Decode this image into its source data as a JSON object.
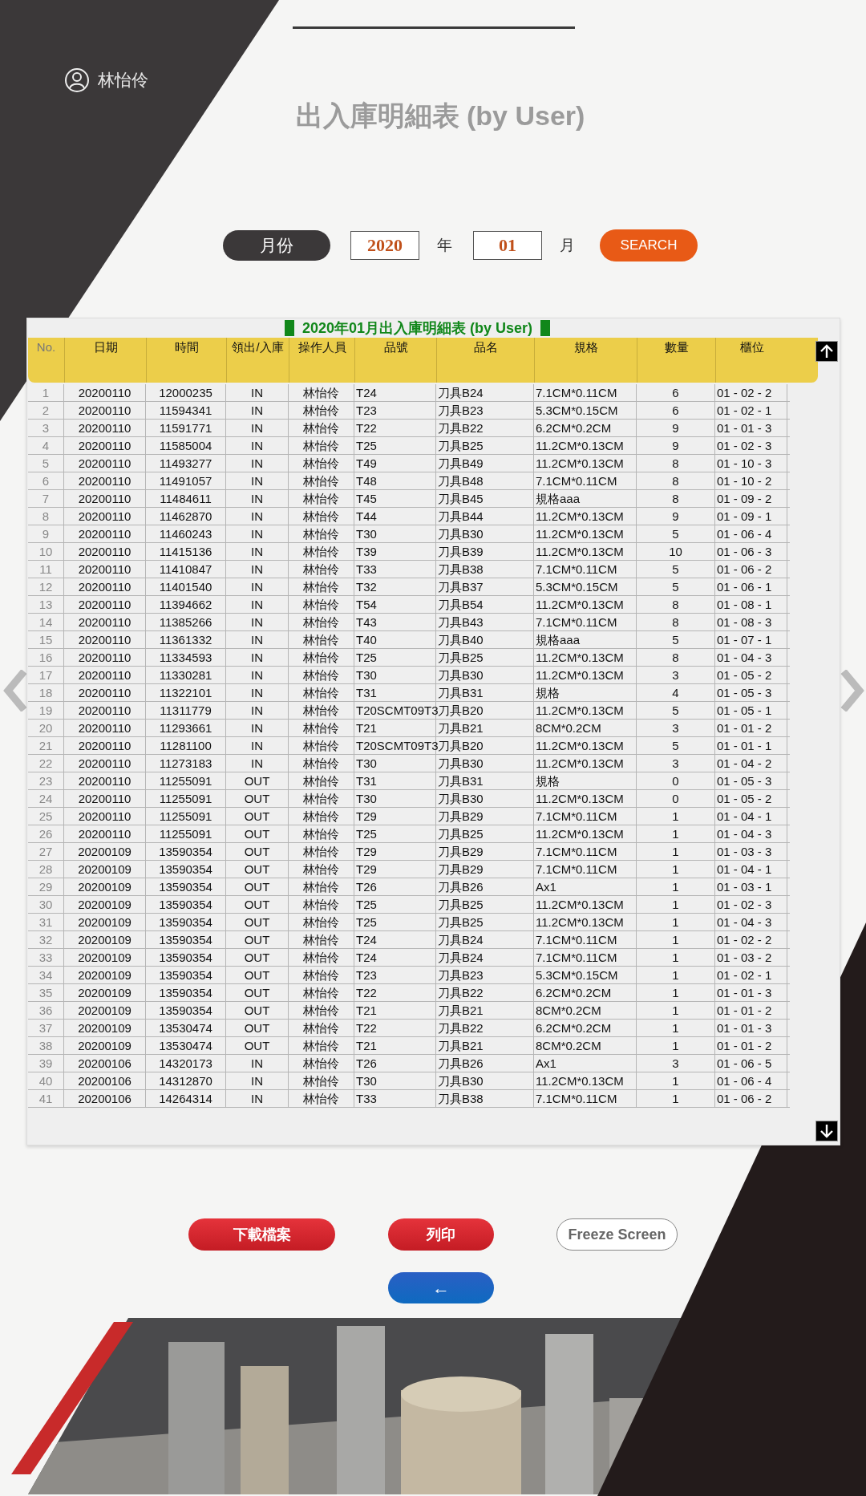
{
  "user": {
    "name": "林怡伶"
  },
  "title": "出入庫明細表 (by User)",
  "search": {
    "label": "月份",
    "year": "2020",
    "year_unit": "年",
    "month": "01",
    "month_unit": "月",
    "button": "SEARCH"
  },
  "table": {
    "caption": "2020年01月出入庫明細表 (by User)",
    "columns": [
      "No.",
      "日期",
      "時間",
      "領出/入庫",
      "操作人員",
      "品號",
      "品名",
      "規格",
      "數量",
      "櫃位"
    ],
    "rows": [
      [
        "1",
        "20200110",
        "12000235",
        "IN",
        "林怡伶",
        "T24",
        "刀具B24",
        "7.1CM*0.11CM",
        "6",
        "01 - 02 - 2"
      ],
      [
        "2",
        "20200110",
        "11594341",
        "IN",
        "林怡伶",
        "T23",
        "刀具B23",
        "5.3CM*0.15CM",
        "6",
        "01 - 02 - 1"
      ],
      [
        "3",
        "20200110",
        "11591771",
        "IN",
        "林怡伶",
        "T22",
        "刀具B22",
        "6.2CM*0.2CM",
        "9",
        "01 - 01 - 3"
      ],
      [
        "4",
        "20200110",
        "11585004",
        "IN",
        "林怡伶",
        "T25",
        "刀具B25",
        "11.2CM*0.13CM",
        "9",
        "01 - 02 - 3"
      ],
      [
        "5",
        "20200110",
        "11493277",
        "IN",
        "林怡伶",
        "T49",
        "刀具B49",
        "11.2CM*0.13CM",
        "8",
        "01 - 10 - 3"
      ],
      [
        "6",
        "20200110",
        "11491057",
        "IN",
        "林怡伶",
        "T48",
        "刀具B48",
        "7.1CM*0.11CM",
        "8",
        "01 - 10 - 2"
      ],
      [
        "7",
        "20200110",
        "11484611",
        "IN",
        "林怡伶",
        "T45",
        "刀具B45",
        "規格aaa",
        "8",
        "01 - 09 - 2"
      ],
      [
        "8",
        "20200110",
        "11462870",
        "IN",
        "林怡伶",
        "T44",
        "刀具B44",
        "11.2CM*0.13CM",
        "9",
        "01 - 09 - 1"
      ],
      [
        "9",
        "20200110",
        "11460243",
        "IN",
        "林怡伶",
        "T30",
        "刀具B30",
        "11.2CM*0.13CM",
        "5",
        "01 - 06 - 4"
      ],
      [
        "10",
        "20200110",
        "11415136",
        "IN",
        "林怡伶",
        "T39",
        "刀具B39",
        "11.2CM*0.13CM",
        "10",
        "01 - 06 - 3"
      ],
      [
        "11",
        "20200110",
        "11410847",
        "IN",
        "林怡伶",
        "T33",
        "刀具B38",
        "7.1CM*0.11CM",
        "5",
        "01 - 06 - 2"
      ],
      [
        "12",
        "20200110",
        "11401540",
        "IN",
        "林怡伶",
        "T32",
        "刀具B37",
        "5.3CM*0.15CM",
        "5",
        "01 - 06 - 1"
      ],
      [
        "13",
        "20200110",
        "11394662",
        "IN",
        "林怡伶",
        "T54",
        "刀具B54",
        "11.2CM*0.13CM",
        "8",
        "01 - 08 - 1"
      ],
      [
        "14",
        "20200110",
        "11385266",
        "IN",
        "林怡伶",
        "T43",
        "刀具B43",
        "7.1CM*0.11CM",
        "8",
        "01 - 08 - 3"
      ],
      [
        "15",
        "20200110",
        "11361332",
        "IN",
        "林怡伶",
        "T40",
        "刀具B40",
        "規格aaa",
        "5",
        "01 - 07 - 1"
      ],
      [
        "16",
        "20200110",
        "11334593",
        "IN",
        "林怡伶",
        "T25",
        "刀具B25",
        "11.2CM*0.13CM",
        "8",
        "01 - 04 - 3"
      ],
      [
        "17",
        "20200110",
        "11330281",
        "IN",
        "林怡伶",
        "T30",
        "刀具B30",
        "11.2CM*0.13CM",
        "3",
        "01 - 05 - 2"
      ],
      [
        "18",
        "20200110",
        "11322101",
        "IN",
        "林怡伶",
        "T31",
        "刀具B31",
        "規格",
        "4",
        "01 - 05 - 3"
      ],
      [
        "19",
        "20200110",
        "11311779",
        "IN",
        "林怡伶",
        "T20SCMT09T3",
        "刀具B20",
        "11.2CM*0.13CM",
        "5",
        "01 - 05 - 1"
      ],
      [
        "20",
        "20200110",
        "11293661",
        "IN",
        "林怡伶",
        "T21",
        "刀具B21",
        "8CM*0.2CM",
        "3",
        "01 - 01 - 2"
      ],
      [
        "21",
        "20200110",
        "11281100",
        "IN",
        "林怡伶",
        "T20SCMT09T3",
        "刀具B20",
        "11.2CM*0.13CM",
        "5",
        "01 - 01 - 1"
      ],
      [
        "22",
        "20200110",
        "11273183",
        "IN",
        "林怡伶",
        "T30",
        "刀具B30",
        "11.2CM*0.13CM",
        "3",
        "01 - 04 - 2"
      ],
      [
        "23",
        "20200110",
        "11255091",
        "OUT",
        "林怡伶",
        "T31",
        "刀具B31",
        "規格",
        "0",
        "01 - 05 - 3"
      ],
      [
        "24",
        "20200110",
        "11255091",
        "OUT",
        "林怡伶",
        "T30",
        "刀具B30",
        "11.2CM*0.13CM",
        "0",
        "01 - 05 - 2"
      ],
      [
        "25",
        "20200110",
        "11255091",
        "OUT",
        "林怡伶",
        "T29",
        "刀具B29",
        "7.1CM*0.11CM",
        "1",
        "01 - 04 - 1"
      ],
      [
        "26",
        "20200110",
        "11255091",
        "OUT",
        "林怡伶",
        "T25",
        "刀具B25",
        "11.2CM*0.13CM",
        "1",
        "01 - 04 - 3"
      ],
      [
        "27",
        "20200109",
        "13590354",
        "OUT",
        "林怡伶",
        "T29",
        "刀具B29",
        "7.1CM*0.11CM",
        "1",
        "01 - 03 - 3"
      ],
      [
        "28",
        "20200109",
        "13590354",
        "OUT",
        "林怡伶",
        "T29",
        "刀具B29",
        "7.1CM*0.11CM",
        "1",
        "01 - 04 - 1"
      ],
      [
        "29",
        "20200109",
        "13590354",
        "OUT",
        "林怡伶",
        "T26",
        "刀具B26",
        "Ax1",
        "1",
        "01 - 03 - 1"
      ],
      [
        "30",
        "20200109",
        "13590354",
        "OUT",
        "林怡伶",
        "T25",
        "刀具B25",
        "11.2CM*0.13CM",
        "1",
        "01 - 02 - 3"
      ],
      [
        "31",
        "20200109",
        "13590354",
        "OUT",
        "林怡伶",
        "T25",
        "刀具B25",
        "11.2CM*0.13CM",
        "1",
        "01 - 04 - 3"
      ],
      [
        "32",
        "20200109",
        "13590354",
        "OUT",
        "林怡伶",
        "T24",
        "刀具B24",
        "7.1CM*0.11CM",
        "1",
        "01 - 02 - 2"
      ],
      [
        "33",
        "20200109",
        "13590354",
        "OUT",
        "林怡伶",
        "T24",
        "刀具B24",
        "7.1CM*0.11CM",
        "1",
        "01 - 03 - 2"
      ],
      [
        "34",
        "20200109",
        "13590354",
        "OUT",
        "林怡伶",
        "T23",
        "刀具B23",
        "5.3CM*0.15CM",
        "1",
        "01 - 02 - 1"
      ],
      [
        "35",
        "20200109",
        "13590354",
        "OUT",
        "林怡伶",
        "T22",
        "刀具B22",
        "6.2CM*0.2CM",
        "1",
        "01 - 01 - 3"
      ],
      [
        "36",
        "20200109",
        "13590354",
        "OUT",
        "林怡伶",
        "T21",
        "刀具B21",
        "8CM*0.2CM",
        "1",
        "01 - 01 - 2"
      ],
      [
        "37",
        "20200109",
        "13530474",
        "OUT",
        "林怡伶",
        "T22",
        "刀具B22",
        "6.2CM*0.2CM",
        "1",
        "01 - 01 - 3"
      ],
      [
        "38",
        "20200109",
        "13530474",
        "OUT",
        "林怡伶",
        "T21",
        "刀具B21",
        "8CM*0.2CM",
        "1",
        "01 - 01 - 2"
      ],
      [
        "39",
        "20200106",
        "14320173",
        "IN",
        "林怡伶",
        "T26",
        "刀具B26",
        "Ax1",
        "3",
        "01 - 06 - 5"
      ],
      [
        "40",
        "20200106",
        "14312870",
        "IN",
        "林怡伶",
        "T30",
        "刀具B30",
        "11.2CM*0.13CM",
        "1",
        "01 - 06 - 4"
      ],
      [
        "41",
        "20200106",
        "14264314",
        "IN",
        "林怡伶",
        "T33",
        "刀具B38",
        "7.1CM*0.11CM",
        "1",
        "01 - 06 - 2"
      ]
    ]
  },
  "actions": [
    "下載檔案",
    "列印",
    "Freeze Screen"
  ],
  "back_button": "←"
}
